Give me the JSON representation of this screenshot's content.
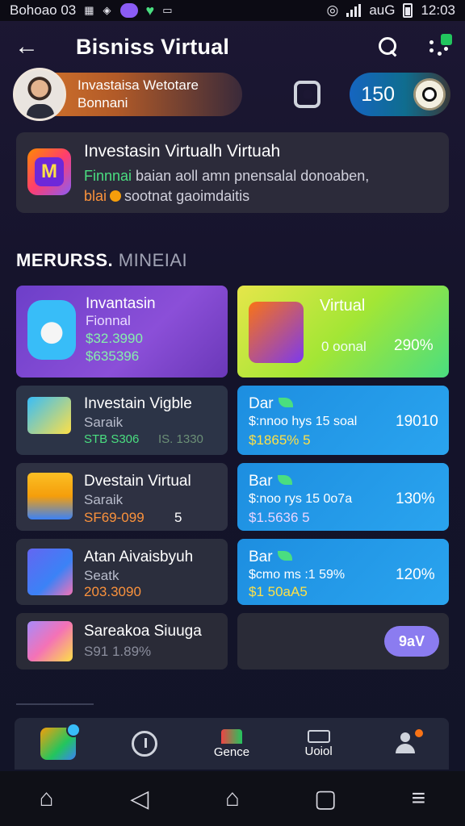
{
  "status_bar": {
    "left_text": "Bohoao 03",
    "icons": [
      "grid-icon",
      "wallet-icon",
      "viber-icon",
      "heart-icon",
      "cast-icon"
    ],
    "carrier": "auG",
    "time": "12:03"
  },
  "header": {
    "title": "Bisniss Virtual"
  },
  "profile": {
    "line1": "Invastaisa Wetotare",
    "line2": "Bonnani"
  },
  "coins": {
    "value": "150"
  },
  "banner": {
    "title": "Investasin Virtualh Virtuah",
    "desc1_hl": "Finnnai",
    "desc1_rest": " baian aoll amn pnensalal donoaben,",
    "desc2_hl": "blai",
    "desc2_rest": "sootnat gaoimdaitis"
  },
  "section": {
    "title": "MERURSS.",
    "subtitle": " MINEIAI"
  },
  "cards": {
    "c1": {
      "title": "Invantasin",
      "line1": "Fionnal",
      "line2": "$32.3990",
      "line3": "$635396"
    },
    "c2": {
      "title": "Virtual",
      "line1": "0 oonal",
      "line2": "290%"
    },
    "c3": {
      "title": "Investain Vigble",
      "line1": "Saraik",
      "line2": "STB S306",
      "line3": "IS. 1330"
    },
    "c4": {
      "title": "Dar",
      "line1": "$:nnoo hys 15 soal",
      "line2": "19010",
      "line3": "$1865% 5"
    },
    "c5": {
      "title": "Dvestain Virtual",
      "line1": "Saraik",
      "line2": "SF69-099",
      "line3": "5"
    },
    "c6": {
      "title": "Bar",
      "line1": "$:noo rys 15 0o7a",
      "line2": "130%",
      "line3": "$1.5636 5"
    },
    "c7": {
      "title": "Atan Aivaisbyuh",
      "line1": "Seatk",
      "line2": "203.3090"
    },
    "c8": {
      "title": "Bar",
      "line1": "$cmo ms :1 59%",
      "line2": "120%",
      "line3": "$1 50aA5"
    },
    "c9": {
      "title": "Sareakoa Siuuga",
      "line1": "S91 1.89%"
    },
    "c10": {
      "button": "9aV"
    }
  },
  "bottom_tabs": [
    {
      "label": "",
      "icon": "chart-icon"
    },
    {
      "label": "",
      "icon": "clock-icon"
    },
    {
      "label": "Gence",
      "icon": "genre-icon"
    },
    {
      "label": "Uoiol",
      "icon": "wallet-icon"
    },
    {
      "label": "",
      "icon": "user-icon"
    }
  ],
  "colors": {
    "accent_green": "#4ade80",
    "accent_orange": "#fb923c",
    "card_blue": "#2aa4ef",
    "card_purple": "#8b4fd8"
  }
}
